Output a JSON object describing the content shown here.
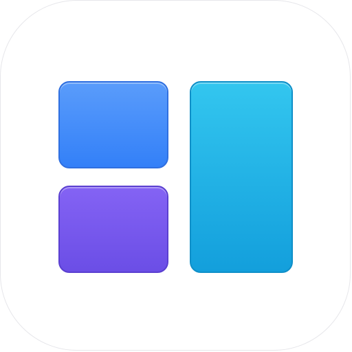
{
  "icon": {
    "name": "layout-grid-icon",
    "background_color": "#ffffff",
    "border_color": "#e6e6ea",
    "tiles": [
      {
        "id": "top-left",
        "color_top": "#5a9cfb",
        "color_bottom": "#3380f8",
        "border_color": "#2f6fe0"
      },
      {
        "id": "bottom-left",
        "color_top": "#8463f4",
        "color_bottom": "#6b4ee6",
        "border_color": "#5a3fd0"
      },
      {
        "id": "right",
        "color_top": "#33c6ef",
        "color_bottom": "#139fdc",
        "border_color": "#0f8fc8"
      }
    ]
  }
}
